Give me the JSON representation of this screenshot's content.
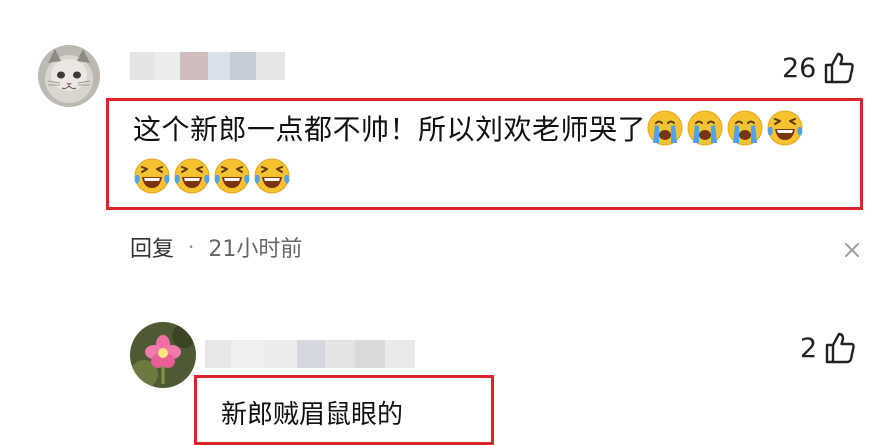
{
  "comments": [
    {
      "avatar": "cat-face-avatar",
      "likes": "26",
      "text": "这个新郎一点都不帅！所以刘欢老师哭了",
      "emoji_row1": [
        "crying-face-icon",
        "crying-face-icon",
        "crying-face-icon",
        "laughing-tears-icon"
      ],
      "emoji_row2": [
        "laughing-tears-icon",
        "laughing-tears-icon",
        "laughing-tears-icon",
        "laughing-tears-icon"
      ],
      "reply_label": "回复",
      "separator": "·",
      "time": "21小时前",
      "close_icon": "close-icon"
    },
    {
      "avatar": "pink-flower-avatar",
      "likes": "2",
      "text": "新郎贼眉鼠眼的"
    }
  ],
  "colors": {
    "highlight_border": "#d9262d",
    "emoji_face": "#f7c22f",
    "emoji_tears": "#4aa3ec"
  }
}
